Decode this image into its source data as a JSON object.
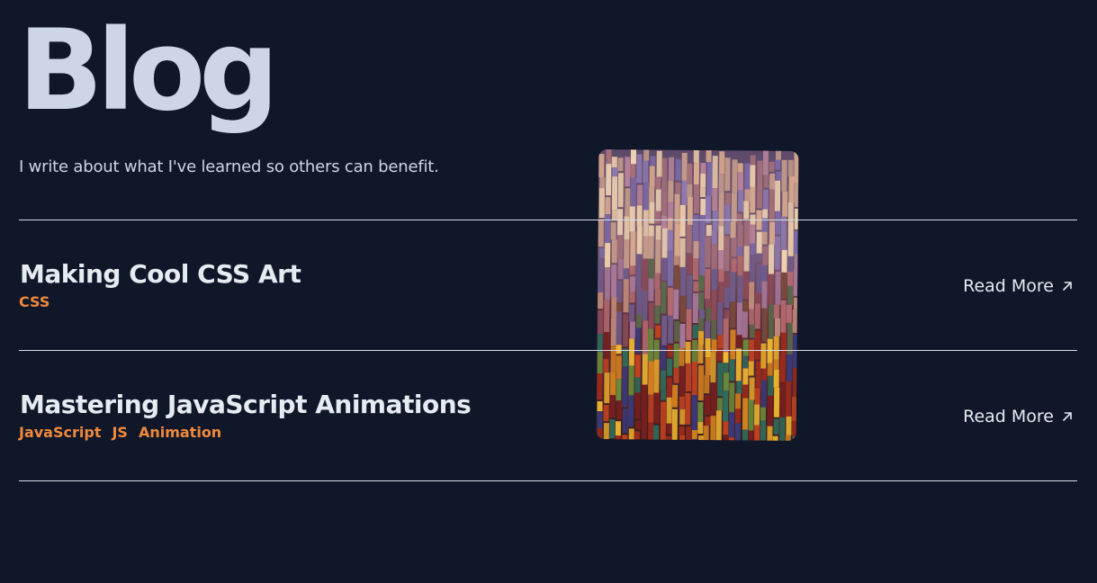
{
  "page": {
    "title": "Blog",
    "subtitle": "I write about what I've learned so others can benefit."
  },
  "posts": [
    {
      "title": "Making Cool CSS Art",
      "tags": [
        "CSS"
      ],
      "read_more_label": "Read More"
    },
    {
      "title": "Mastering JavaScript Animations",
      "tags": [
        "JavaScript",
        "JS",
        "Animation"
      ],
      "read_more_label": "Read More"
    }
  ],
  "icons": {
    "read_more": "arrow-up-right-icon"
  },
  "colors": {
    "background": "#0f1729",
    "text": "#cdd6e4",
    "heading": "#e6ebf2",
    "tag": "#f0893c",
    "divider": "#d7dde6"
  }
}
